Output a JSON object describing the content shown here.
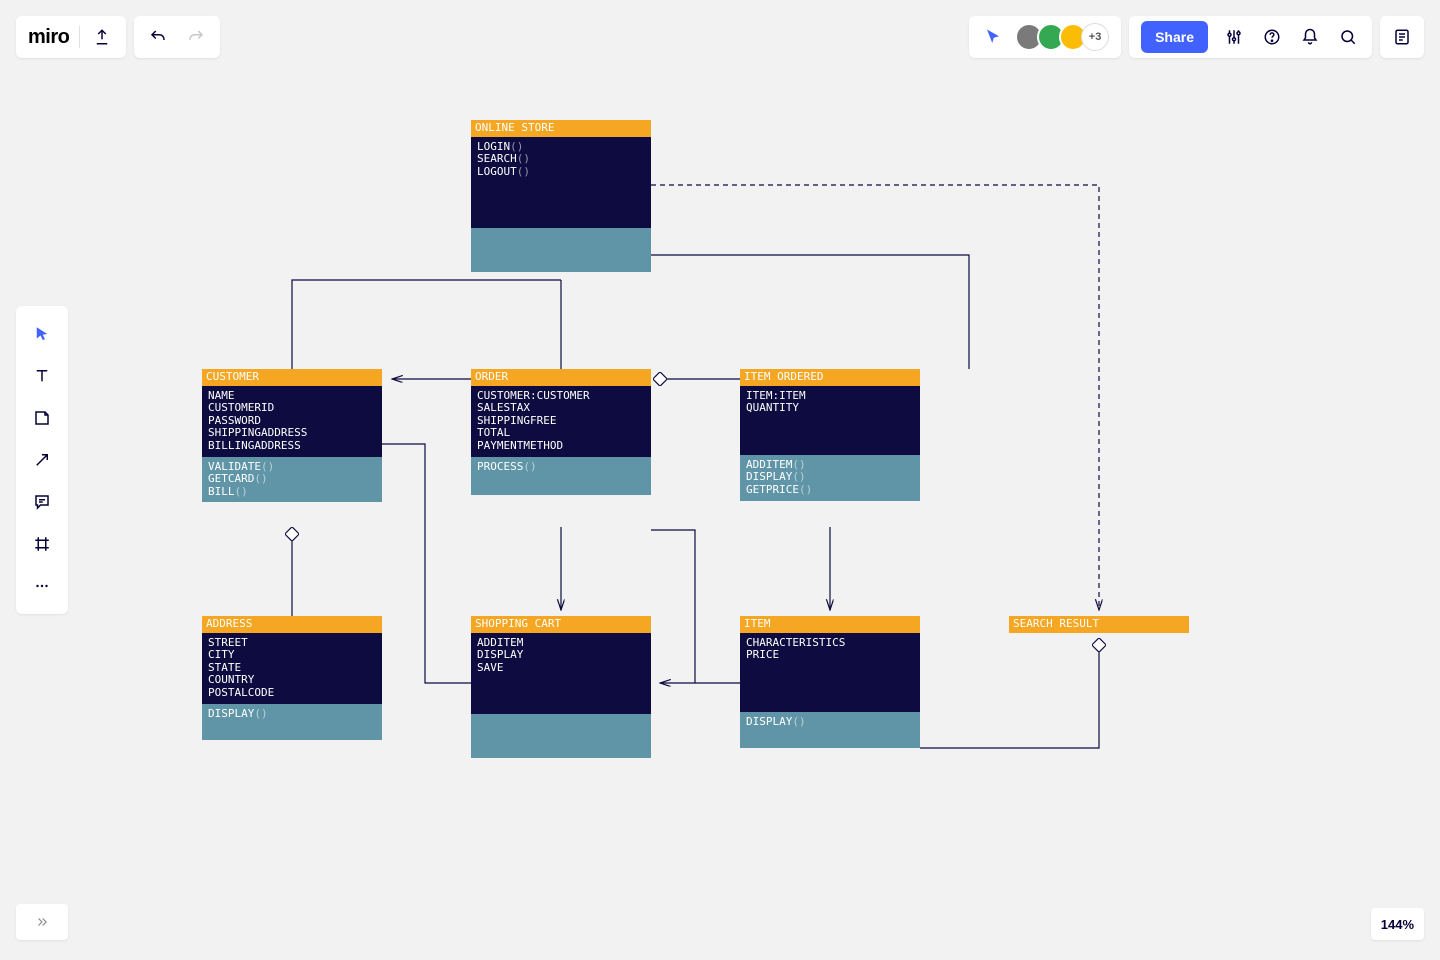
{
  "app": {
    "logo": "miro"
  },
  "toolbar": {
    "share_label": "Share",
    "more_avatars": "+3"
  },
  "zoom_label": "144%",
  "avatars": [
    {
      "bg": "#7a7a7a"
    },
    {
      "bg": "#34a853",
      "ring": "#2e9e4a"
    },
    {
      "bg": "#fbbc05",
      "ring": "#f5a623"
    }
  ],
  "classes": {
    "online_store": {
      "title": "ONLINE STORE",
      "attrs": [
        "LOGIN()",
        "SEARCH()",
        "LOGOUT()"
      ],
      "meths": [],
      "attrs_pad": 50,
      "meths_pad": 40
    },
    "customer": {
      "title": "CUSTOMER",
      "attrs": [
        "NAME",
        "CUSTOMERID",
        "PASSWORD",
        "SHIPPINGADDRESS",
        "BILLINGADDRESS"
      ],
      "meths": [
        "VALIDATE()",
        "GETCARD()",
        "BILL()"
      ]
    },
    "order": {
      "title": "ORDER",
      "attrs": [
        "CUSTOMER:CUSTOMER",
        "SALESTAX",
        "SHIPPINGFREE",
        "TOTAL",
        "PAYMENTMETHOD"
      ],
      "meths": [
        "PROCESS()"
      ],
      "meths_pad": 22
    },
    "item_ordered": {
      "title": "ITEM ORDERED",
      "attrs": [
        "ITEM:ITEM",
        "QUANTITY"
      ],
      "meths": [
        "ADDITEM()",
        "DISPLAY()",
        "GETPRICE()"
      ],
      "attrs_pad": 40
    },
    "address": {
      "title": "ADDRESS",
      "attrs": [
        "STREET",
        "CITY",
        "STATE",
        "COUNTRY",
        "POSTALCODE"
      ],
      "meths": [
        "DISPLAY()"
      ],
      "meths_pad": 20
    },
    "shopping_cart": {
      "title": "SHOPPING CART",
      "attrs": [
        "ADDITEM",
        "DISPLAY",
        "SAVE"
      ],
      "meths": [],
      "attrs_pad": 40,
      "meths_pad": 40
    },
    "item": {
      "title": "ITEM",
      "attrs": [
        "CHARACTERISTICS",
        "PRICE"
      ],
      "meths": [
        "DISPLAY()"
      ],
      "attrs_pad": 50,
      "meths_pad": 20
    },
    "search_result": {
      "title": "SEARCH RESULT",
      "attrs": [],
      "meths": []
    }
  }
}
